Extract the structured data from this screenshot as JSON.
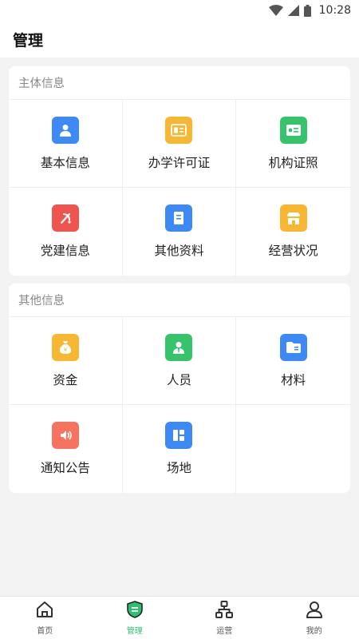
{
  "status_bar": {
    "time": "10:28"
  },
  "header": {
    "title": "管理"
  },
  "sections": [
    {
      "title": "主体信息",
      "items": [
        {
          "label": "基本信息",
          "icon": "person-icon",
          "color": "#3d8af7"
        },
        {
          "label": "办学许可证",
          "icon": "license-card-icon",
          "color": "#f7b733"
        },
        {
          "label": "机构证照",
          "icon": "id-card-icon",
          "color": "#35c46b"
        },
        {
          "label": "党建信息",
          "icon": "party-emblem-icon",
          "color": "#f0544f"
        },
        {
          "label": "其他资料",
          "icon": "document-icon",
          "color": "#3d8af7"
        },
        {
          "label": "经营状况",
          "icon": "shop-icon",
          "color": "#f7b733"
        }
      ]
    },
    {
      "title": "其他信息",
      "items": [
        {
          "label": "资金",
          "icon": "money-bag-icon",
          "color": "#f7b733"
        },
        {
          "label": "人员",
          "icon": "staff-icon",
          "color": "#35c46b"
        },
        {
          "label": "材料",
          "icon": "material-card-icon",
          "color": "#3d8af7"
        },
        {
          "label": "通知公告",
          "icon": "speaker-icon",
          "color": "#f5735f"
        },
        {
          "label": "场地",
          "icon": "venue-layout-icon",
          "color": "#3d8af7"
        }
      ]
    }
  ],
  "bottom_nav": {
    "active_color": "#2fbf71",
    "items": [
      {
        "label": "首页",
        "icon": "home-icon"
      },
      {
        "label": "管理",
        "icon": "manage-shield-icon",
        "active": true
      },
      {
        "label": "运营",
        "icon": "org-chart-icon"
      },
      {
        "label": "我的",
        "icon": "profile-icon"
      }
    ]
  }
}
